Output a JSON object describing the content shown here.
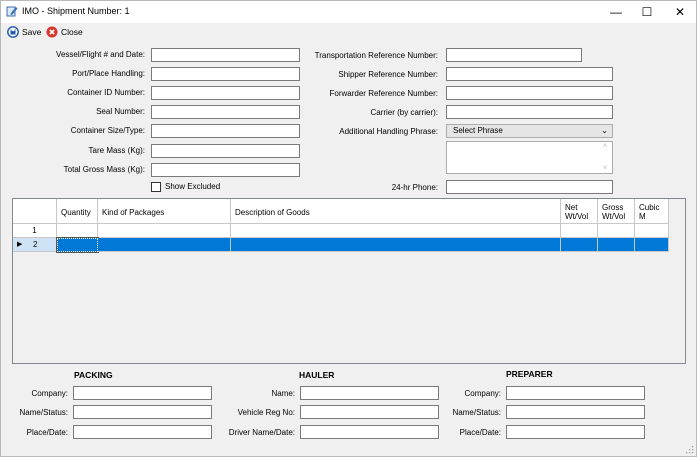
{
  "window": {
    "title": "IMO - Shipment Number: 1",
    "controls": {
      "minimize": "—",
      "maximize": "☐",
      "close": "✕"
    }
  },
  "toolbar": {
    "save_label": "Save",
    "close_label": "Close"
  },
  "left_fields": [
    {
      "label": "Vessel/Flight # and Date:",
      "value": ""
    },
    {
      "label": "Port/Place Handling:",
      "value": ""
    },
    {
      "label": "Container ID Number:",
      "value": ""
    },
    {
      "label": "Seal Number:",
      "value": ""
    },
    {
      "label": "Container Size/Type:",
      "value": ""
    },
    {
      "label": "Tare Mass (Kg):",
      "value": ""
    },
    {
      "label": "Total Gross Mass (Kg):",
      "value": ""
    }
  ],
  "show_excluded": {
    "label": "Show Excluded",
    "checked": false
  },
  "right_fields": [
    {
      "label": "Transportation Reference Number:",
      "value": ""
    },
    {
      "label": "Shipper Reference Number:",
      "value": ""
    },
    {
      "label": "Forwarder Reference Number:",
      "value": ""
    },
    {
      "label": "Carrier (by carrier):",
      "value": ""
    }
  ],
  "handling_phrase": {
    "label": "Additional Handling Phrase:",
    "selected": "Select Phrase",
    "text": ""
  },
  "phone": {
    "label": "24-hr Phone:",
    "value": ""
  },
  "grid": {
    "columns": [
      "Quantity",
      "Kind of Packages",
      "Description of Goods",
      "Net Wt/Vol",
      "Gross Wt/Vol",
      "Cubic M"
    ],
    "rows": [
      {
        "num": "1",
        "cells": [
          "",
          "",
          "",
          "",
          "",
          ""
        ]
      },
      {
        "num": "2",
        "cells": [
          "",
          "",
          "",
          "",
          "",
          ""
        ],
        "selected": true
      }
    ]
  },
  "packing": {
    "heading": "PACKING",
    "fields": [
      {
        "label": "Company:",
        "value": ""
      },
      {
        "label": "Name/Status:",
        "value": ""
      },
      {
        "label": "Place/Date:",
        "value": ""
      }
    ]
  },
  "hauler": {
    "heading": "HAULER",
    "fields": [
      {
        "label": "Name:",
        "value": ""
      },
      {
        "label": "Vehicle Reg No:",
        "value": ""
      },
      {
        "label": "Driver Name/Date:",
        "value": ""
      }
    ]
  },
  "preparer": {
    "heading": "PREPARER",
    "fields": [
      {
        "label": "Company:",
        "value": ""
      },
      {
        "label": "Name/Status:",
        "value": ""
      },
      {
        "label": "Place/Date:",
        "value": ""
      }
    ]
  },
  "colors": {
    "selection": "#0078d7",
    "close_icon": "#d9342b",
    "save_icon": "#1e5aa8"
  }
}
